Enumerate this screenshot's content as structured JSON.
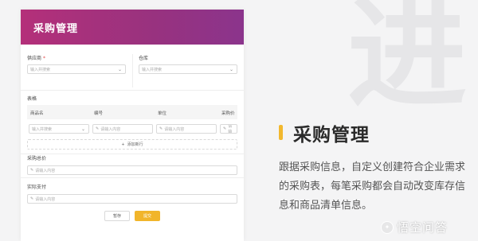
{
  "decor": {
    "big_char": "进"
  },
  "panel": {
    "title": "采购管理",
    "supplier": {
      "label": "供应商",
      "required_mark": "*",
      "placeholder": "输入并搜索"
    },
    "warehouse": {
      "label": "仓库",
      "placeholder": "输入并搜索"
    },
    "table": {
      "label": "表格",
      "columns": [
        "商品名",
        "编号",
        "单位",
        "采购价"
      ],
      "row": [
        "输入并搜索",
        "请输入内容",
        "请输入内容",
        "请输"
      ],
      "add_row": "添加新行"
    },
    "total": {
      "label": "采购总价",
      "placeholder": "请输入内容"
    },
    "paid": {
      "label": "实际支付",
      "placeholder": "请输入内容"
    },
    "buttons": {
      "save": "暂存",
      "submit": "提交"
    }
  },
  "feature": {
    "title": "采购管理",
    "description": "跟据采购信息，自定义创建符合企业需求的采购表，每笔采购都会自动改变库存信息和商品清单信息。"
  },
  "watermark": {
    "text": "悟空问答"
  },
  "colors": {
    "header_start": "#b4307a",
    "header_end": "#8b348c",
    "accent": "#f2b82e",
    "submit": "#f1b52b"
  }
}
